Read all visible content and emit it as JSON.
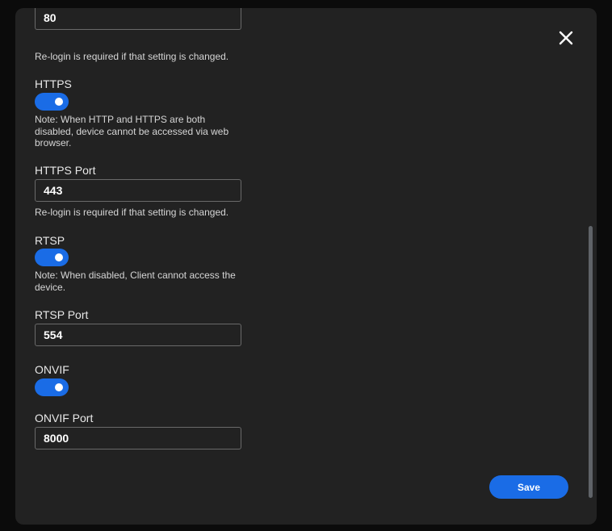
{
  "http_port": {
    "value": "80",
    "note": "Re-login is required if that setting is changed."
  },
  "https": {
    "label": "HTTPS",
    "enabled": true,
    "note": "Note: When HTTP and HTTPS are both disabled, device cannot be accessed via web browser."
  },
  "https_port": {
    "label": "HTTPS Port",
    "value": "443",
    "note": "Re-login is required if that setting is changed."
  },
  "rtsp": {
    "label": "RTSP",
    "enabled": true,
    "note": "Note: When disabled, Client cannot access the device."
  },
  "rtsp_port": {
    "label": "RTSP Port",
    "value": "554"
  },
  "onvif": {
    "label": "ONVIF",
    "enabled": true
  },
  "onvif_port": {
    "label": "ONVIF Port",
    "value": "8000"
  },
  "actions": {
    "save_label": "Save",
    "close_icon": "close-icon"
  },
  "colors": {
    "accent": "#1a6ce6",
    "panel": "#222222",
    "backdrop": "#0b0b0b"
  }
}
